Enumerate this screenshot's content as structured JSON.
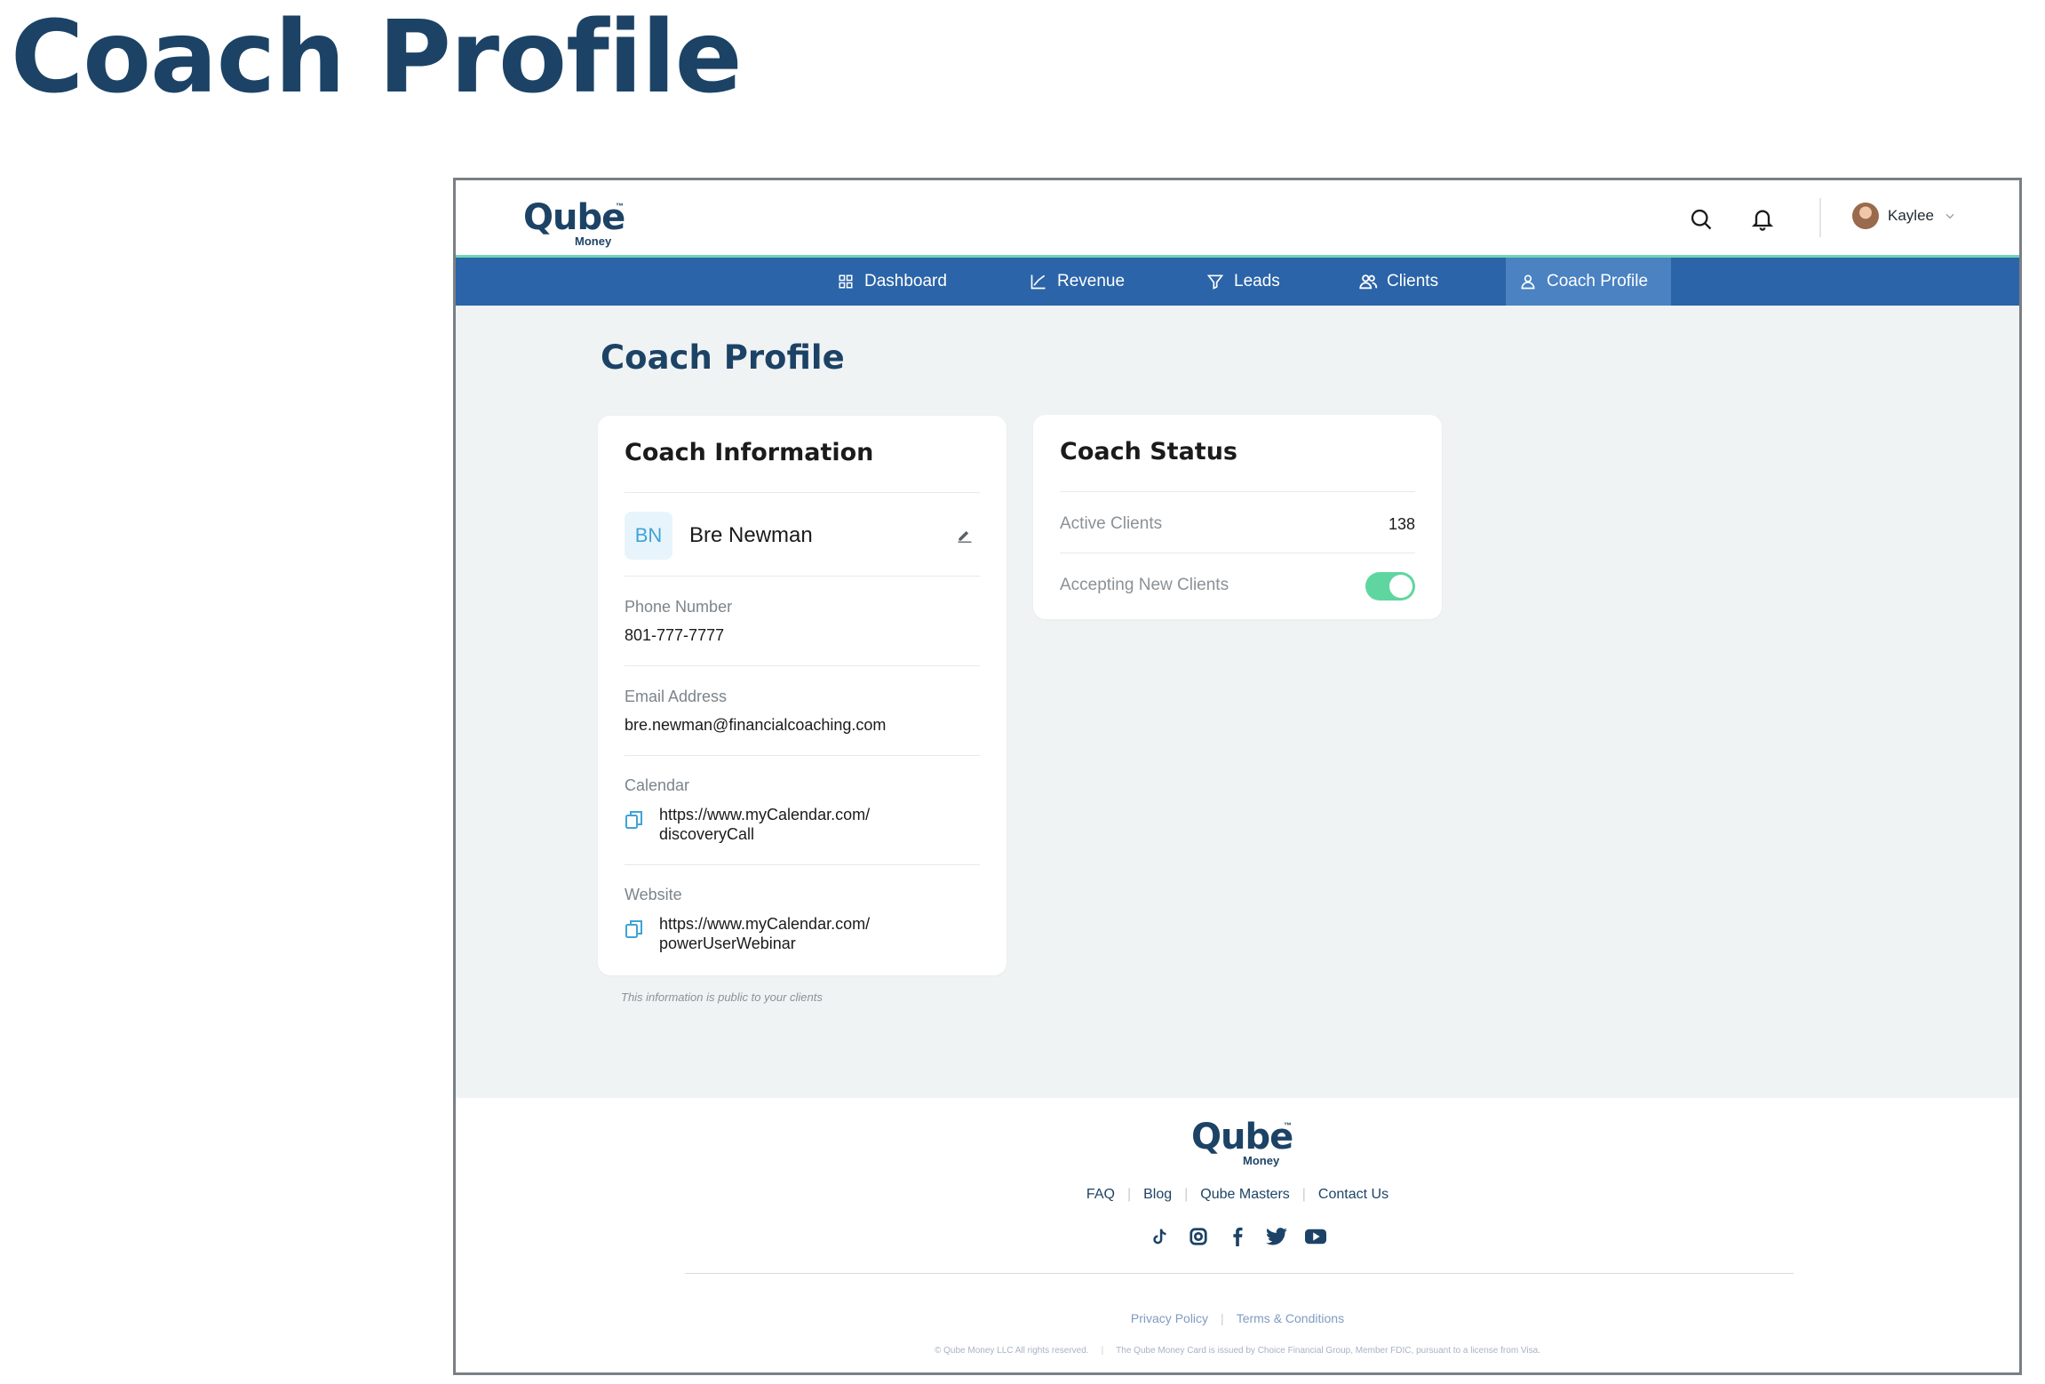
{
  "document_title": "Coach Profile",
  "brand": {
    "logo_text": "Qube",
    "logo_sub": "Money",
    "logo_tm": "™"
  },
  "header": {
    "user_name": "Kaylee"
  },
  "nav": {
    "items": [
      {
        "label": "Dashboard",
        "icon": "grid-icon"
      },
      {
        "label": "Revenue",
        "icon": "chart-line-icon"
      },
      {
        "label": "Leads",
        "icon": "funnel-icon"
      },
      {
        "label": "Clients",
        "icon": "users-icon"
      },
      {
        "label": "Coach Profile",
        "icon": "user-icon",
        "active": true
      }
    ]
  },
  "page": {
    "heading": "Coach Profile"
  },
  "coach_info": {
    "title": "Coach Information",
    "initials": "BN",
    "name": "Bre Newman",
    "phone_label": "Phone Number",
    "phone": "801-777-7777",
    "email_label": "Email Address",
    "email": "bre.newman@financialcoaching.com",
    "calendar_label": "Calendar",
    "calendar_line1": "https://www.myCalendar.com/",
    "calendar_line2": "discoveryCall",
    "website_label": "Website",
    "website_line1": "https://www.myCalendar.com/",
    "website_line2": "powerUserWebinar",
    "public_note": "This information is public to your clients"
  },
  "coach_status": {
    "title": "Coach Status",
    "active_clients_label": "Active Clients",
    "active_clients": "138",
    "accepting_label": "Accepting New Clients",
    "accepting": true
  },
  "footer": {
    "links": [
      "FAQ",
      "Blog",
      "Qube Masters",
      "Contact Us"
    ],
    "social": [
      "tiktok-icon",
      "instagram-icon",
      "facebook-icon",
      "twitter-icon",
      "youtube-icon"
    ],
    "legal": [
      "Privacy Policy",
      "Terms & Conditions"
    ],
    "copyright": "© Qube Money LLC All rights reserved.",
    "card_notice": "The Qube Money Card is issued by Choice Financial Group, Member FDIC, pursuant to a license from Visa."
  },
  "colors": {
    "brand_navy": "#1c4366",
    "nav_blue": "#2b64a8",
    "nav_active": "#4a82c2",
    "accent_green": "#5fd6a0"
  }
}
